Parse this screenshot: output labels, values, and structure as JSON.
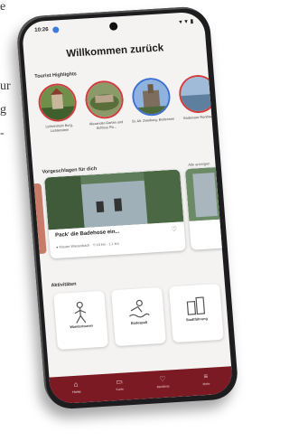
{
  "edge_text": [
    "e",
    "ur",
    "g",
    "-"
  ],
  "status": {
    "time": "10:26",
    "icons": "▾ ▼ ▮"
  },
  "header": {
    "title": "Willkommen zurück"
  },
  "highlights": {
    "heading": "Tourist Highlights",
    "items": [
      {
        "label": "Lichtenstein Burg, Lichtenstein"
      },
      {
        "label": "Alexander-Garten und Schloss Ro..."
      },
      {
        "label": "St. Alt. Zweiburg, Bodensee"
      },
      {
        "label": "Bodensee Rundwege"
      }
    ]
  },
  "suggestions": {
    "heading": "Vorgeschlagen für dich",
    "more": "Alle anzeigen",
    "card": {
      "title": "Pack' die Badehose ein...",
      "meta": "● Kloster Wiesenbach · ⏱ 10 km · 1.1 km"
    }
  },
  "activities": {
    "heading": "Aktivitäten",
    "items": [
      {
        "label": "Wandertouren"
      },
      {
        "label": "Badespaß"
      },
      {
        "label": "Stadtführung"
      }
    ]
  },
  "tabs": [
    {
      "label": "Home"
    },
    {
      "label": "Karte"
    },
    {
      "label": "Merkliste"
    },
    {
      "label": "Mehr"
    }
  ],
  "colors": {
    "brand": "#7b1a22",
    "accent": "#d23b3b"
  }
}
